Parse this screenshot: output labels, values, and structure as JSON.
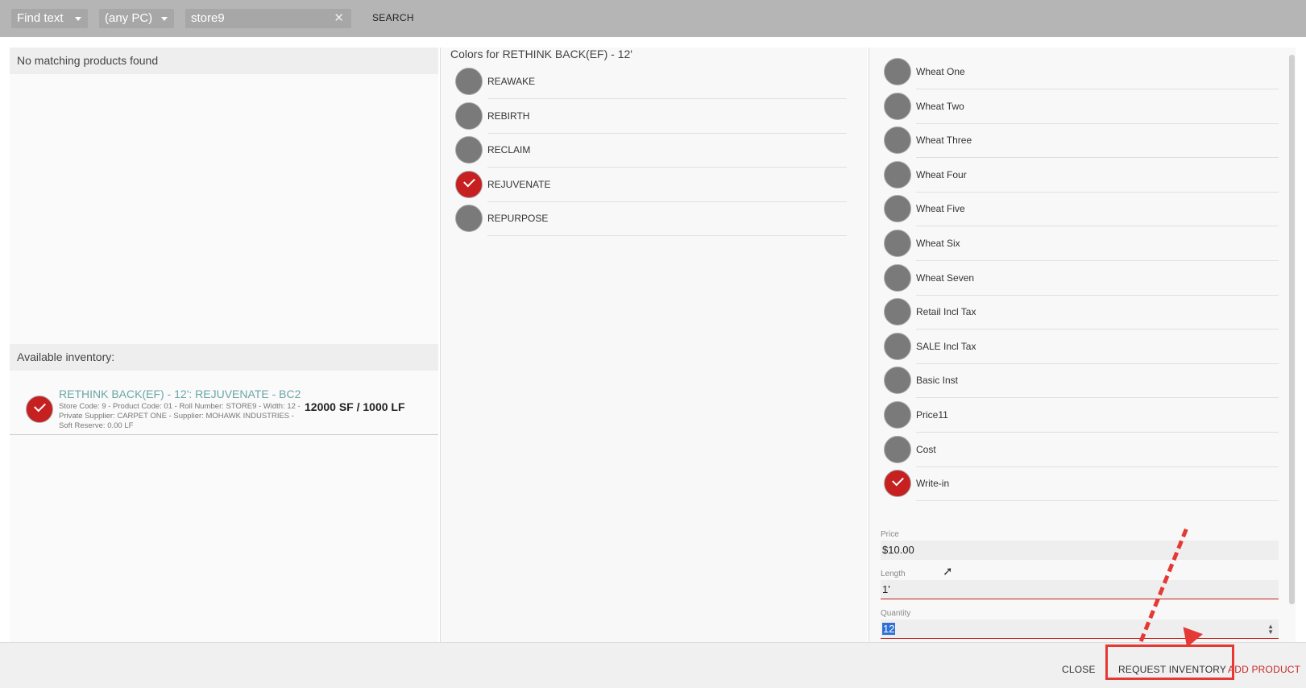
{
  "toolbar": {
    "find_dropdown": "Find text",
    "pc_dropdown": "(any PC)",
    "search_value": "store9",
    "search_button": "SEARCH"
  },
  "left": {
    "no_match": "No matching products found",
    "available_label": "Available inventory:",
    "item": {
      "title": "RETHINK BACK(EF) - 12': REJUVENATE - BC2",
      "detail": "Store Code: 9 - Product Code: 01 - Roll Number: STORE9 - Width: 12 - Private Supplier: CARPET ONE - Supplier: MOHAWK INDUSTRIES - Soft Reserve: 0.00 LF",
      "qty": "12000 SF / 1000 LF"
    }
  },
  "middle": {
    "title": "Colors for RETHINK BACK(EF) - 12'",
    "colors": [
      {
        "label": "REAWAKE",
        "selected": false
      },
      {
        "label": "REBIRTH",
        "selected": false
      },
      {
        "label": "RECLAIM",
        "selected": false
      },
      {
        "label": "REJUVENATE",
        "selected": true
      },
      {
        "label": "REPURPOSE",
        "selected": false
      }
    ]
  },
  "right": {
    "prices": [
      {
        "label": "Wheat One",
        "selected": false
      },
      {
        "label": "Wheat Two",
        "selected": false
      },
      {
        "label": "Wheat Three",
        "selected": false
      },
      {
        "label": "Wheat Four",
        "selected": false
      },
      {
        "label": "Wheat Five",
        "selected": false
      },
      {
        "label": "Wheat Six",
        "selected": false
      },
      {
        "label": "Wheat Seven",
        "selected": false
      },
      {
        "label": "Retail Incl Tax",
        "selected": false
      },
      {
        "label": "SALE Incl Tax",
        "selected": false
      },
      {
        "label": "Basic Inst",
        "selected": false
      },
      {
        "label": "Price11",
        "selected": false
      },
      {
        "label": "Cost",
        "selected": false
      },
      {
        "label": "Write-in",
        "selected": true
      }
    ],
    "price_label": "Price",
    "price_value": "$10.00",
    "length_label": "Length",
    "length_value": "1'",
    "quantity_label": "Quantity",
    "quantity_value": "12"
  },
  "footer": {
    "close": "CLOSE",
    "request_inventory": "REQUEST INVENTORY",
    "add_product": "ADD PRODUCT"
  },
  "colors": {
    "selected": "#c62020",
    "unselected": "#7a7a7a",
    "annotation": "#e53935"
  }
}
